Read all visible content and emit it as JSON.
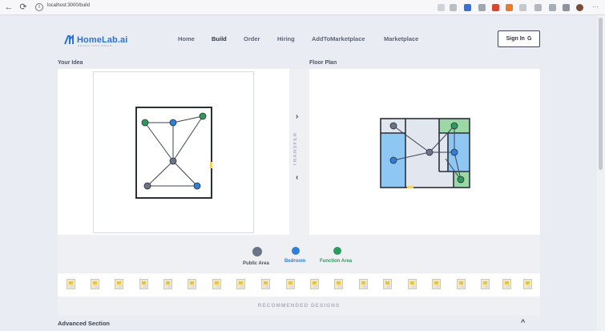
{
  "browser": {
    "url": "localhost:3000/build",
    "back": "←",
    "reload": "⟳",
    "info": "i",
    "menu": "···"
  },
  "header": {
    "logo_text": "HomeLab.ai",
    "logo_tagline": "DESIGN YOUR DREAM",
    "nav": [
      "Home",
      "Build",
      "Order",
      "Hiring",
      "AddToMarketplace",
      "Marketplace"
    ],
    "active_nav": "Build",
    "sign_in": "Sign In",
    "sign_in_icon": "G"
  },
  "labels": {
    "your_idea": "Your Idea",
    "floor_plan": "Floor Plan",
    "transfer": "TRANSFER",
    "arrow_right": "›",
    "arrow_left": "‹"
  },
  "legend": [
    {
      "label": "Public Area",
      "color": "#6b7487",
      "icon": "grey-circle"
    },
    {
      "label": "Bedroom",
      "color": "#2f7fd4",
      "icon": "blue-circle"
    },
    {
      "label": "Function Area",
      "color": "#2f9a5e",
      "icon": "green-circle"
    }
  ],
  "colors": {
    "public": "#6b7487",
    "bedroom": "#2f7fd4",
    "function": "#2f9a5e",
    "bedroom_fill": "#8ec7f2",
    "function_fill": "#9bd8a6",
    "public_fill": "#e1e6ef"
  },
  "thumbnail_count": 20,
  "recommended_label": "RECOMMENDED DESIGNS",
  "advanced_label": "Advanced Section",
  "advanced_caret": "^"
}
